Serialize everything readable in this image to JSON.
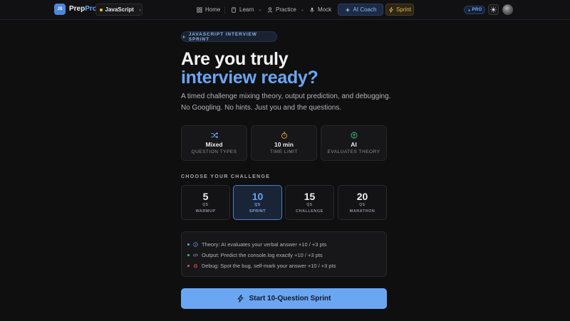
{
  "header": {
    "logo_badge": "JS",
    "brand_main": "Prep",
    "brand_accent": "Pro",
    "language": "JavaScript",
    "nav": [
      {
        "label": "Home",
        "icon": "grid-icon"
      },
      {
        "label": "Learn",
        "icon": "book-icon"
      },
      {
        "label": "Practice",
        "icon": "person-icon"
      },
      {
        "label": "Mock",
        "icon": "mic-icon"
      }
    ],
    "ai_coach": "AI Coach",
    "sprint": "Sprint",
    "pro_badge": "PRO"
  },
  "hero": {
    "eyebrow": "JAVASCRIPT INTERVIEW SPRINT",
    "title_line1": "Are you truly",
    "title_line2": "interview ready?",
    "subtitle": "A timed challenge mixing theory, output prediction, and debugging. No Googling. No hints. Just you and the questions."
  },
  "features": [
    {
      "title": "Mixed",
      "subtitle": "QUESTION TYPES",
      "icon": "shuffle-icon",
      "color": "#6aa5f2"
    },
    {
      "title": "10 min",
      "subtitle": "TIME LIMIT",
      "icon": "stopwatch-icon",
      "color": "#e8a23a"
    },
    {
      "title": "AI",
      "subtitle": "EVALUATES THEORY",
      "icon": "ai-icon",
      "color": "#3fbf7a"
    }
  ],
  "challenge_section": {
    "label": "CHOOSE YOUR CHALLENGE",
    "options": [
      {
        "count": "5",
        "qs": "QS",
        "label": "WARMUP",
        "selected": false
      },
      {
        "count": "10",
        "qs": "QS",
        "label": "SPRINT",
        "selected": true
      },
      {
        "count": "15",
        "qs": "QS",
        "label": "CHALLENGE",
        "selected": false
      },
      {
        "count": "20",
        "qs": "QS",
        "label": "MARATHON",
        "selected": false
      }
    ]
  },
  "info": [
    {
      "text": "Theory: AI evaluates your verbal answer +10 / +3 pts",
      "dot_color": "#6aa5f2",
      "icon": "info-icon"
    },
    {
      "text": "Output: Predict the console.log exactly +10 / +3 pts",
      "dot_color": "#3fbf7a",
      "icon": "code-icon"
    },
    {
      "text": "Debug: Spot the bug, self-mark your answer +10 / +3 pts",
      "dot_color": "#e0574f",
      "icon": "bug-icon"
    }
  ],
  "start_button": "Start 10-Question Sprint"
}
